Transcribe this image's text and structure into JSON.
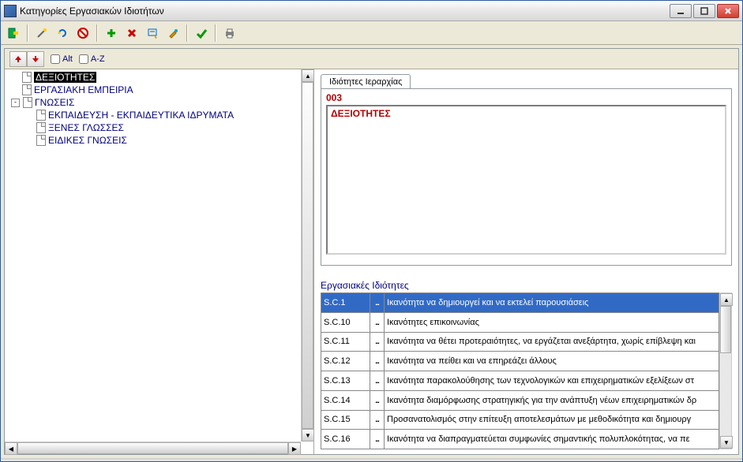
{
  "window": {
    "title": "Κατηγορίες Εργασιακών Ιδιοτήτων"
  },
  "toolbar": {
    "exit": "exit",
    "wand": "wand",
    "refresh": "refresh",
    "cancelx": "cancel",
    "add": "add",
    "del": "del",
    "edit": "edit",
    "paint": "paint",
    "ok": "ok",
    "print": "print"
  },
  "subtoolbar": {
    "up": "↑",
    "down": "↓",
    "altLabel": "Alt",
    "azLabel": "A-Z"
  },
  "tree": {
    "items": [
      {
        "label": "ΔΕΞΙΟΤΗΤΕΣ",
        "level": 0,
        "selected": true,
        "expandable": false
      },
      {
        "label": "ΕΡΓΑΣΙΑΚΗ ΕΜΠΕΙΡΙΑ",
        "level": 0,
        "selected": false,
        "expandable": false
      },
      {
        "label": "ΓΝΩΣΕΙΣ",
        "level": 0,
        "selected": false,
        "expandable": true,
        "expanded": true,
        "expSym": "-"
      },
      {
        "label": "ΕΚΠΑΙΔΕΥΣΗ - ΕΚΠΑΙΔΕΥΤΙΚΑ ΙΔΡΥΜΑΤΑ",
        "level": 1,
        "selected": false,
        "expandable": false
      },
      {
        "label": "ΞΕΝΕΣ ΓΛΩΣΣΕΣ",
        "level": 1,
        "selected": false,
        "expandable": false
      },
      {
        "label": "ΕΙΔΙΚΕΣ ΓΝΩΣΕΙΣ",
        "level": 1,
        "selected": false,
        "expandable": false
      }
    ]
  },
  "detail": {
    "tabLabel": "Ιδιότητες Ιεραρχίας",
    "code": "003",
    "name": "ΔΕΞΙΟΤΗΤΕΣ"
  },
  "table": {
    "title": "Εργασιακές Ιδιότητες",
    "rows": [
      {
        "code": "S.C.1",
        "btn": "...",
        "desc": "Ικανότητα να δημιουργεί και να εκτελεί παρουσιάσεις",
        "selected": true
      },
      {
        "code": "S.C.10",
        "btn": "...",
        "desc": "Ικανότητες επικοινωνίας",
        "selected": false
      },
      {
        "code": "S.C.11",
        "btn": "...",
        "desc": "Ικανότητα να θέτει προτεραιότητες, να εργάζεται ανεξάρτητα, χωρίς επίβλεψη και",
        "selected": false
      },
      {
        "code": "S.C.12",
        "btn": "...",
        "desc": "Ικανότητα να πείθει και να επηρεάζει άλλους",
        "selected": false
      },
      {
        "code": "S.C.13",
        "btn": "...",
        "desc": "Ικανότητα παρακολούθησης των τεχνολογικών και επιχειρηματικών εξελίξεων στ",
        "selected": false
      },
      {
        "code": "S.C.14",
        "btn": "...",
        "desc": "Ικανότητα διαμόρφωσης στρατηγικής για την ανάπτυξη νέων επιχειρηματικών δρ",
        "selected": false
      },
      {
        "code": "S.C.15",
        "btn": "...",
        "desc": "Προσανατολισμός στην επίτευξη αποτελεσμάτων με μεθοδικότητα και δημιουργ",
        "selected": false
      },
      {
        "code": "S.C.16",
        "btn": "...",
        "desc": "Ικανότητα να διαπραγματεύεται συμφωνίες σημαντικής πολυπλοκότητας, να πε",
        "selected": false
      }
    ]
  }
}
